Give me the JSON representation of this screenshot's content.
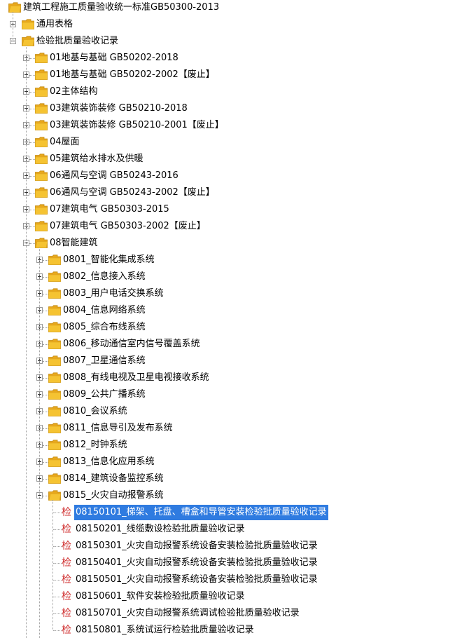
{
  "tree": {
    "root": {
      "label": "建筑工程施工质量验收统一标准GB50300-2013"
    },
    "general_forms": {
      "label": "通用表格"
    },
    "inspection_records": {
      "label": "检验批质量验收记录"
    },
    "chapters": [
      {
        "label": "01地基与基础 GB50202-2018"
      },
      {
        "label": "01地基与基础 GB50202-2002【废止】"
      },
      {
        "label": "02主体结构"
      },
      {
        "label": "03建筑装饰装修 GB50210-2018"
      },
      {
        "label": "03建筑装饰装修 GB50210-2001【废止】"
      },
      {
        "label": "04屋面"
      },
      {
        "label": "05建筑给水排水及供暖"
      },
      {
        "label": "06通风与空调 GB50243-2016"
      },
      {
        "label": "06通风与空调 GB50243-2002【废止】"
      },
      {
        "label": "07建筑电气 GB50303-2015"
      },
      {
        "label": "07建筑电气 GB50303-2002【废止】"
      }
    ],
    "smart_building": {
      "label": "08智能建筑"
    },
    "subsystems": [
      {
        "label": "0801_智能化集成系统"
      },
      {
        "label": "0802_信息接入系统"
      },
      {
        "label": "0803_用户电话交换系统"
      },
      {
        "label": "0804_信息网络系统"
      },
      {
        "label": "0805_综合布线系统"
      },
      {
        "label": "0806_移动通信室内信号覆盖系统"
      },
      {
        "label": "0807_卫星通信系统"
      },
      {
        "label": "0808_有线电视及卫星电视接收系统"
      },
      {
        "label": "0809_公共广播系统"
      },
      {
        "label": "0810_会议系统"
      },
      {
        "label": "0811_信息导引及发布系统"
      },
      {
        "label": "0812_时钟系统"
      },
      {
        "label": "0813_信息化应用系统"
      },
      {
        "label": "0814_建筑设备监控系统"
      }
    ],
    "fire_alarm": {
      "label": "0815_火灾自动报警系统"
    },
    "record_icon_glyph": "检",
    "record_icon_color": "#d03030",
    "selection_color": "#2f7be0",
    "folder_color": "#f5c332",
    "records": [
      {
        "label": "08150101_梯架、托盘、槽盒和导管安装检验批质量验收记录",
        "selected": true
      },
      {
        "label": "08150201_线缆敷设检验批质量验收记录"
      },
      {
        "label": "08150301_火灾自动报警系统设备安装检验批质量验收记录"
      },
      {
        "label": "08150401_火灾自动报警系统设备安装检验批质量验收记录"
      },
      {
        "label": "08150501_火灾自动报警系统设备安装检验批质量验收记录"
      },
      {
        "label": "08150601_软件安装检验批质量验收记录"
      },
      {
        "label": "08150701_火灾自动报警系统调试检验批质量验收记录"
      },
      {
        "label": "08150801_系统试运行检验批质量验收记录"
      }
    ]
  }
}
